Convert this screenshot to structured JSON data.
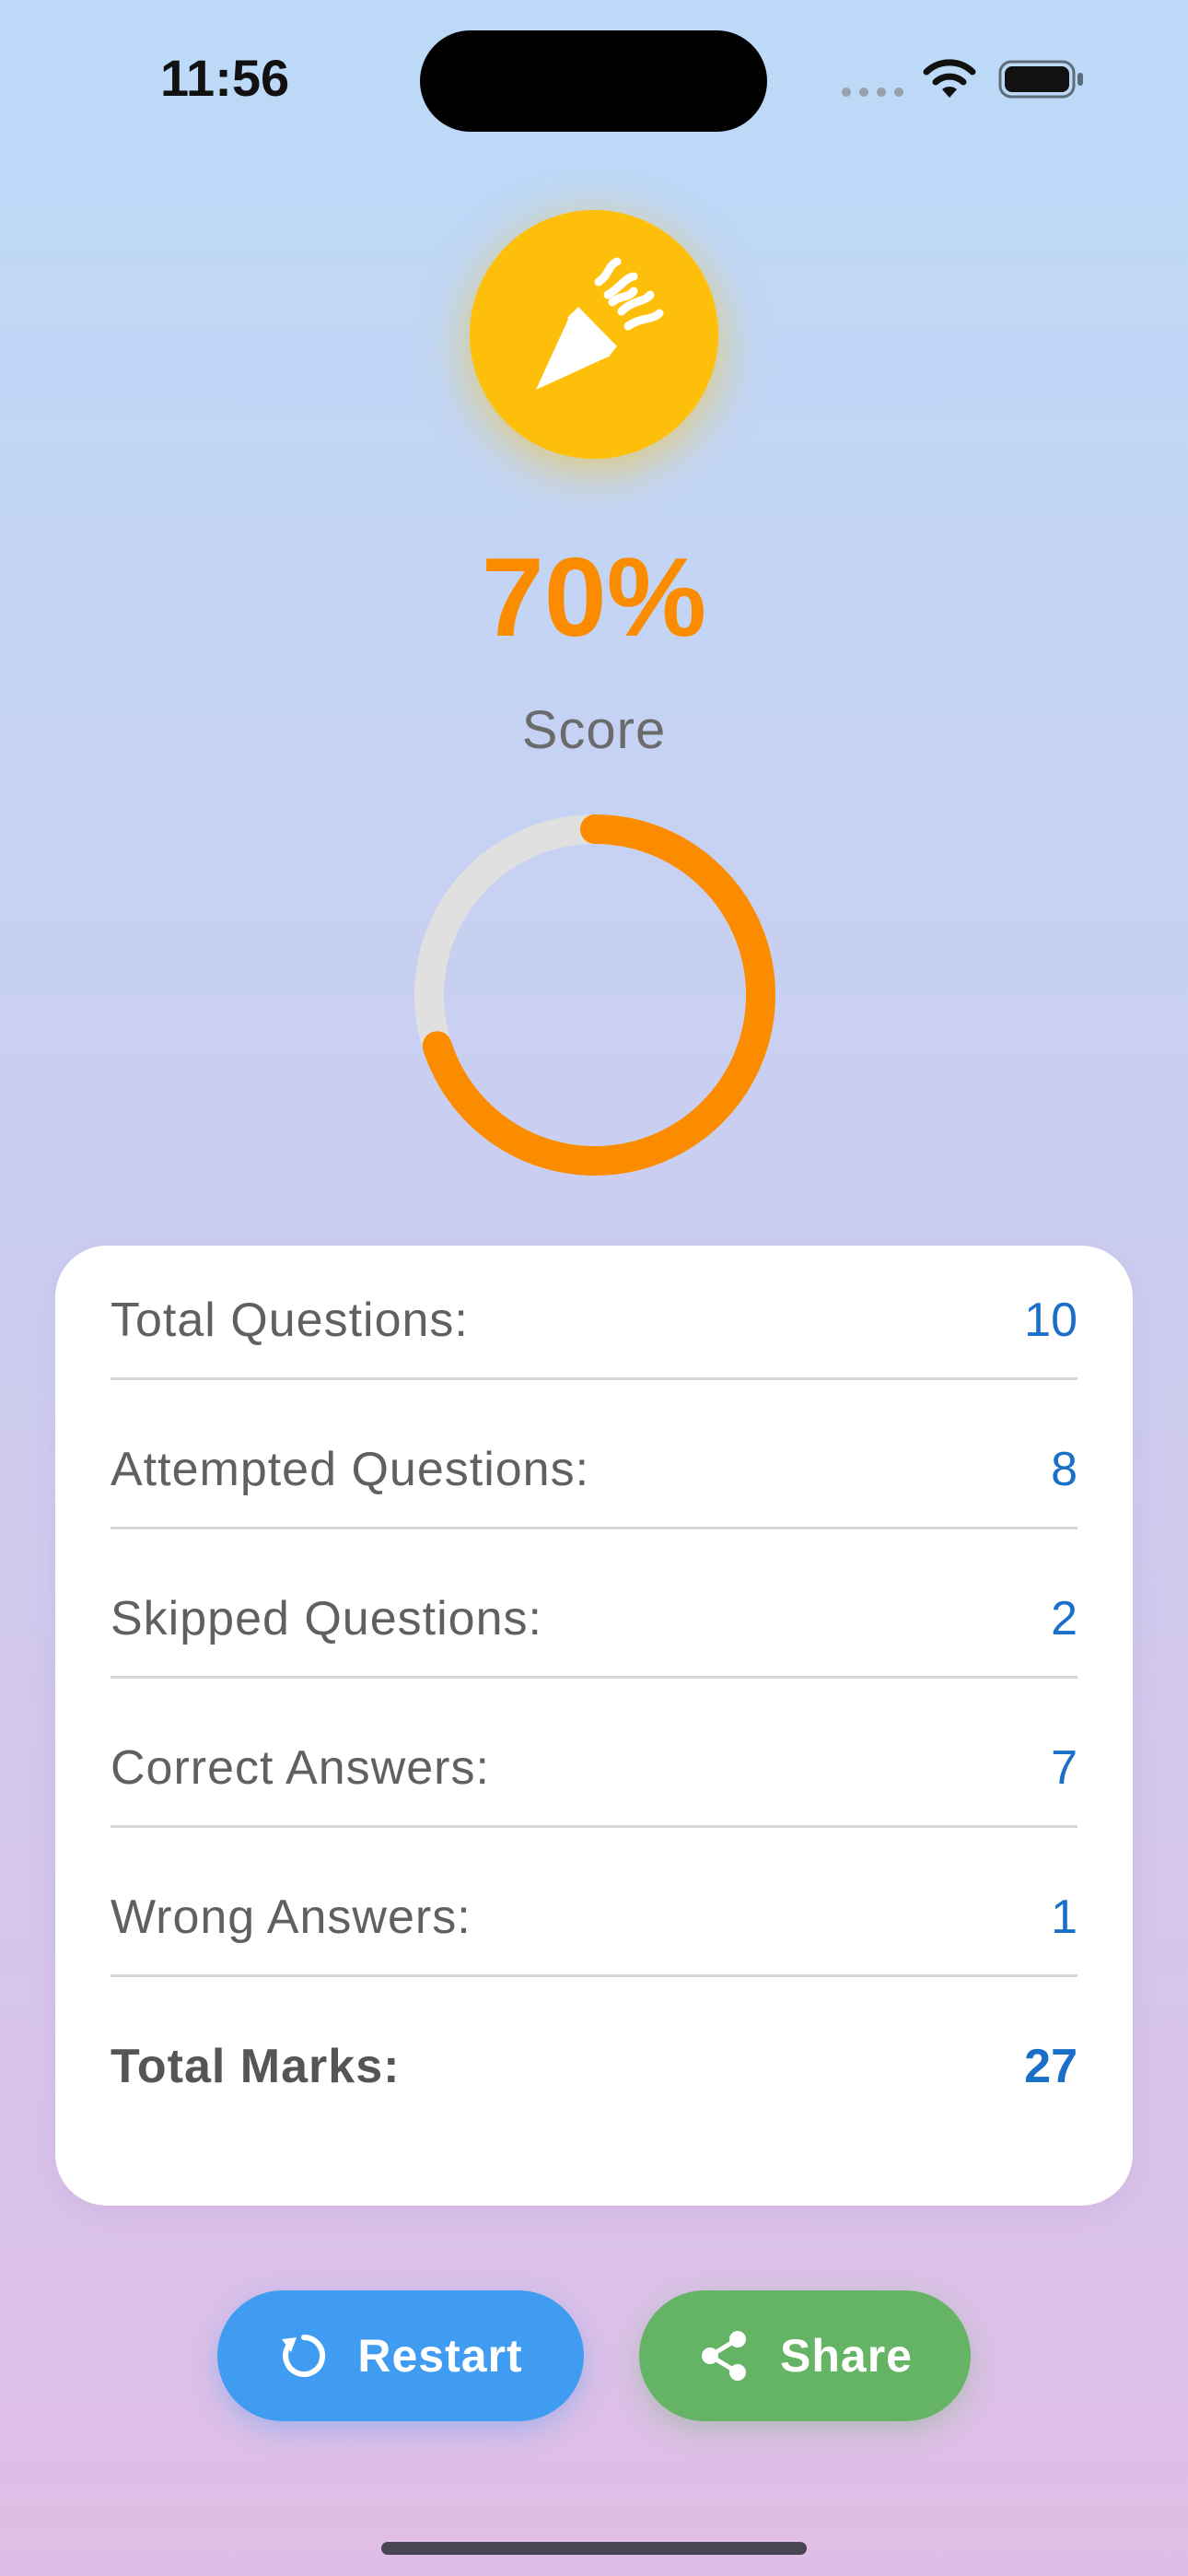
{
  "status_bar": {
    "time": "11:56"
  },
  "result": {
    "badge_icon": "party-popper-icon",
    "score_percent": "70%",
    "score_label": "Score",
    "score_progress": 0.7
  },
  "stats": {
    "rows": [
      {
        "label": "Total Questions:",
        "value": "10"
      },
      {
        "label": "Attempted Questions:",
        "value": "8"
      },
      {
        "label": "Skipped Questions:",
        "value": "2"
      },
      {
        "label": "Correct Answers:",
        "value": "7"
      },
      {
        "label": "Wrong Answers:",
        "value": "1"
      }
    ],
    "total": {
      "label": "Total Marks:",
      "value": "27"
    }
  },
  "actions": {
    "restart_label": "Restart",
    "restart_icon": "refresh-icon",
    "share_label": "Share",
    "share_icon": "share-icon"
  },
  "colors": {
    "accent_orange": "#fb8c00",
    "badge_yellow": "#fdbf0a",
    "value_blue": "#1a6fc9",
    "restart_blue": "#3f9cf0",
    "share_green": "#65b465",
    "ring_track": "#e0e0e0"
  }
}
